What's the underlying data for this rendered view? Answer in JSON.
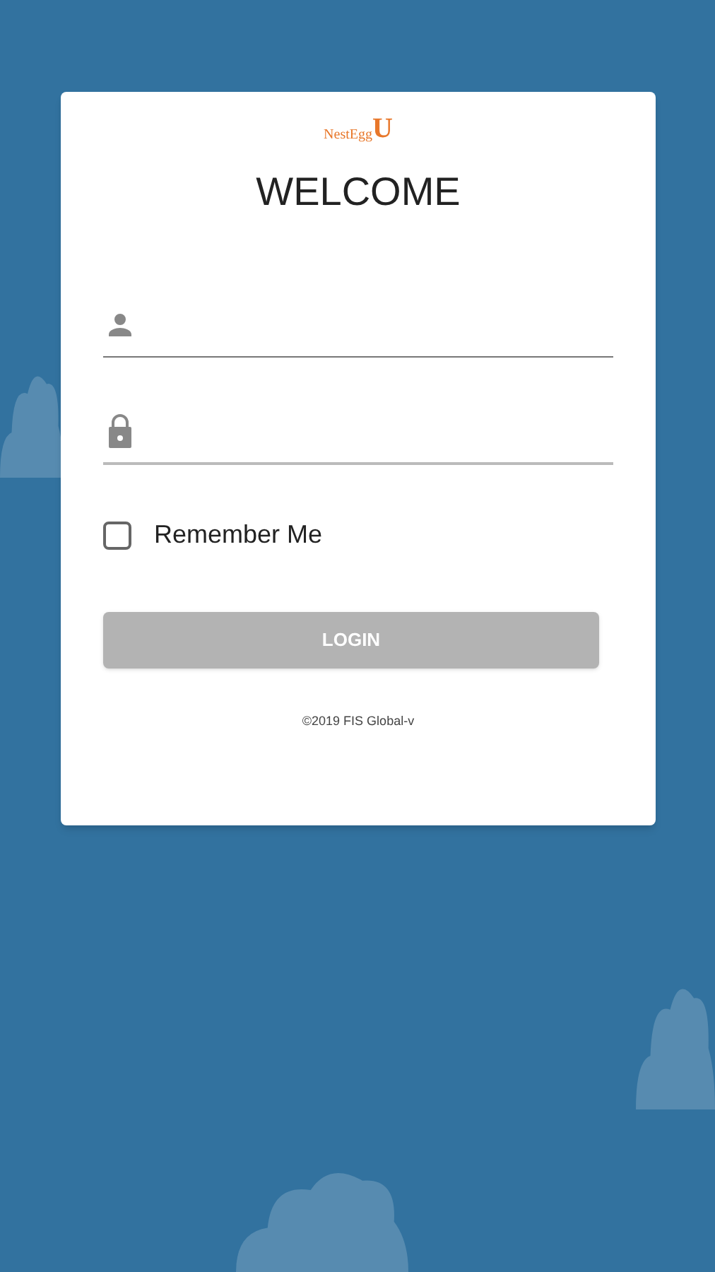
{
  "logo": {
    "word": "NestEgg",
    "letter": "U"
  },
  "title": "WELCOME",
  "remember_me": {
    "label": "Remember Me",
    "checked": false
  },
  "login_button": {
    "label": "LOGIN",
    "disabled": true
  },
  "footer": "©2019 FIS Global-v"
}
